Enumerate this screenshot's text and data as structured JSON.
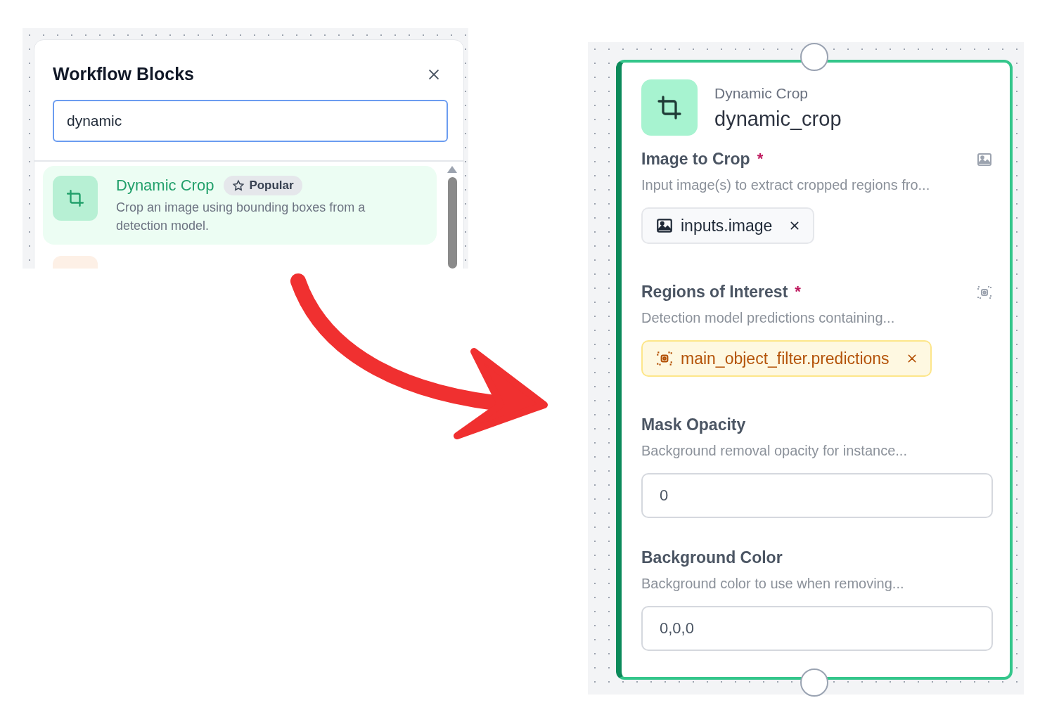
{
  "blocks_panel": {
    "title": "Workflow Blocks",
    "search": {
      "value": "dynamic"
    },
    "results": [
      {
        "title": "Dynamic Crop",
        "badge": "Popular",
        "description": "Crop an image using bounding boxes from a detection model.",
        "selected": true
      }
    ]
  },
  "block_node": {
    "type_name": "Dynamic Crop",
    "name": "dynamic_crop",
    "fields": [
      {
        "kind": "image",
        "label": "Image to Crop",
        "required_mark": "*",
        "description": "Input image(s) to extract cropped regions fro...",
        "value": "inputs.image"
      },
      {
        "kind": "detections",
        "label": "Regions of Interest",
        "required_mark": "*",
        "description": "Detection model predictions containing...",
        "value": "main_object_filter.predictions"
      },
      {
        "kind": "number",
        "label": "Mask Opacity",
        "description": "Background removal opacity for instance...",
        "value": "0"
      },
      {
        "kind": "text",
        "label": "Background Color",
        "description": "Background color to use when removing...",
        "value": "0,0,0"
      }
    ]
  }
}
